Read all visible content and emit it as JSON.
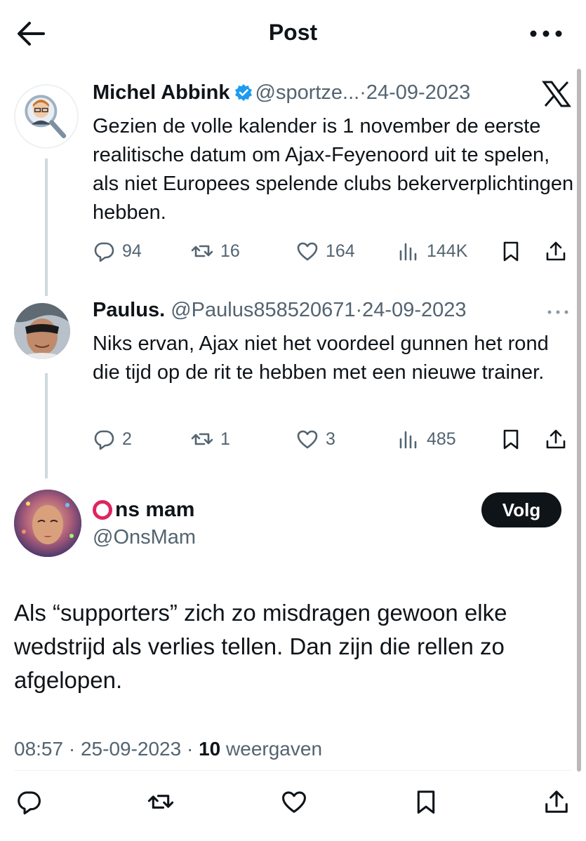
{
  "header": {
    "title": "Post"
  },
  "quoted": [
    {
      "name": "Michel Abbink",
      "handle": "@sportze...",
      "sep": "·",
      "date": "24-09-2023",
      "text": "Gezien de volle kalender is 1 november de eerste realitische datum om Ajax-Feyenoord uit te spelen, als niet Europees spelende clubs bekerverplichtingen hebben.",
      "stats": {
        "replies": "94",
        "reposts": "16",
        "likes": "164",
        "views": "144K"
      }
    },
    {
      "name": "Paulus.",
      "handle": "@Paulus858520671",
      "sep": "·",
      "date": "24-09-2023",
      "text": "Niks ervan, Ajax niet het voordeel gunnen het rond die tijd op de rit te hebben met een nieuwe trainer.",
      "stats": {
        "replies": "2",
        "reposts": "1",
        "likes": "3",
        "views": "485"
      }
    }
  ],
  "main": {
    "name": "ns mam",
    "handle": "@OnsMam",
    "follow_label": "Volg",
    "text": "Als “supporters” zich zo misdragen gewoon elke wedstrijd als verlies tellen. Dan zijn die rellen zo afgelopen.",
    "time": "08:57",
    "sep": "·",
    "date": "25-09-2023",
    "views_count": "10",
    "views_label": "weergaven"
  },
  "colors": {
    "accent": "#1d9bf0",
    "text": "#0f1419",
    "muted": "#536471",
    "ring": "#e0245e",
    "follow_bg": "#0f1419"
  },
  "icons": [
    "back-arrow-icon",
    "more-icon",
    "verified-badge-icon",
    "x-logo-icon",
    "reply-icon",
    "repost-icon",
    "like-icon",
    "views-icon",
    "bookmark-icon",
    "share-icon"
  ]
}
